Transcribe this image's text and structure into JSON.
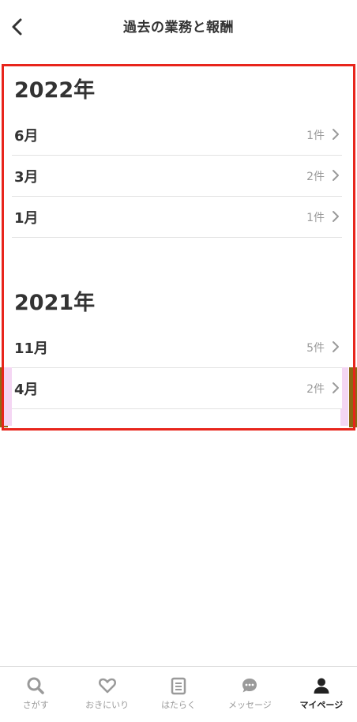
{
  "header": {
    "title": "過去の業務と報酬",
    "back_icon": "chevron-left-icon"
  },
  "years": [
    {
      "label": "2022年",
      "months": [
        {
          "label": "6月",
          "count": "1件"
        },
        {
          "label": "3月",
          "count": "2件"
        },
        {
          "label": "1月",
          "count": "1件"
        }
      ]
    },
    {
      "label": "2021年",
      "months": [
        {
          "label": "11月",
          "count": "5件"
        },
        {
          "label": "4月",
          "count": "2件"
        }
      ]
    }
  ],
  "tabbar": {
    "tabs": [
      {
        "label": "さがす",
        "icon": "search-icon",
        "active": false
      },
      {
        "label": "おきにいり",
        "icon": "heart-icon",
        "active": false
      },
      {
        "label": "はたらく",
        "icon": "clipboard-icon",
        "active": false
      },
      {
        "label": "メッセージ",
        "icon": "chat-bubble-icon",
        "active": false
      },
      {
        "label": "マイページ",
        "icon": "person-icon",
        "active": true
      }
    ]
  },
  "colors": {
    "highlight": "#e8251c",
    "text": "#333333",
    "muted": "#9a9a9a",
    "divider": "#e2e2e2"
  }
}
